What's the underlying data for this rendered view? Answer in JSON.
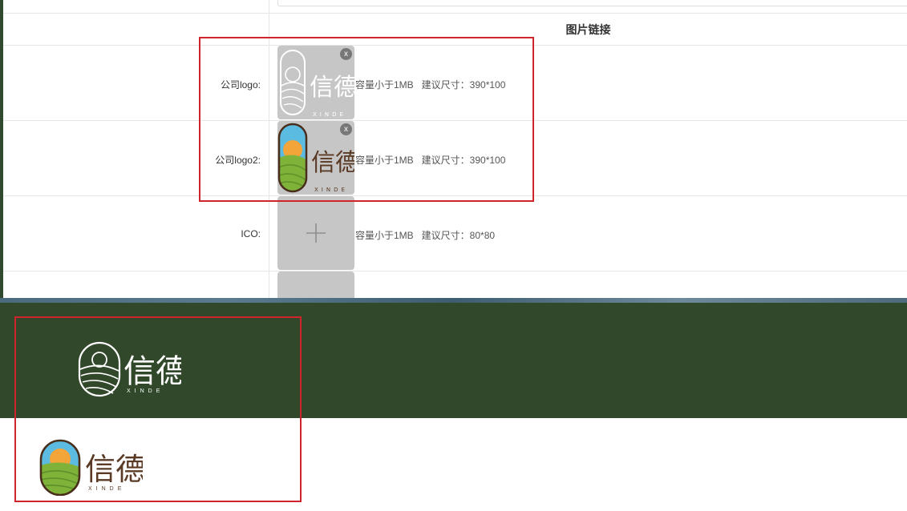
{
  "form": {
    "column_header": "图片链接",
    "rows": [
      {
        "label": "公司logo:",
        "hint": "容量小于1MB   建议尺寸：390*100",
        "close": "x"
      },
      {
        "label": "公司logo2:",
        "hint": "容量小于1MB   建议尺寸：390*100",
        "close": "x"
      },
      {
        "label": "ICO:",
        "hint": "容量小于1MB   建议尺寸：80*80"
      }
    ]
  },
  "brand": {
    "name": "信德",
    "subtitle": "XINDE"
  },
  "colors": {
    "highlight": "#d0242c",
    "dark_green": "#31482b",
    "sky_blue": "#5bbbe0",
    "sun_orange": "#f3a53a",
    "field_green": "#7fb239",
    "brand_brown": "#5a3a25"
  }
}
